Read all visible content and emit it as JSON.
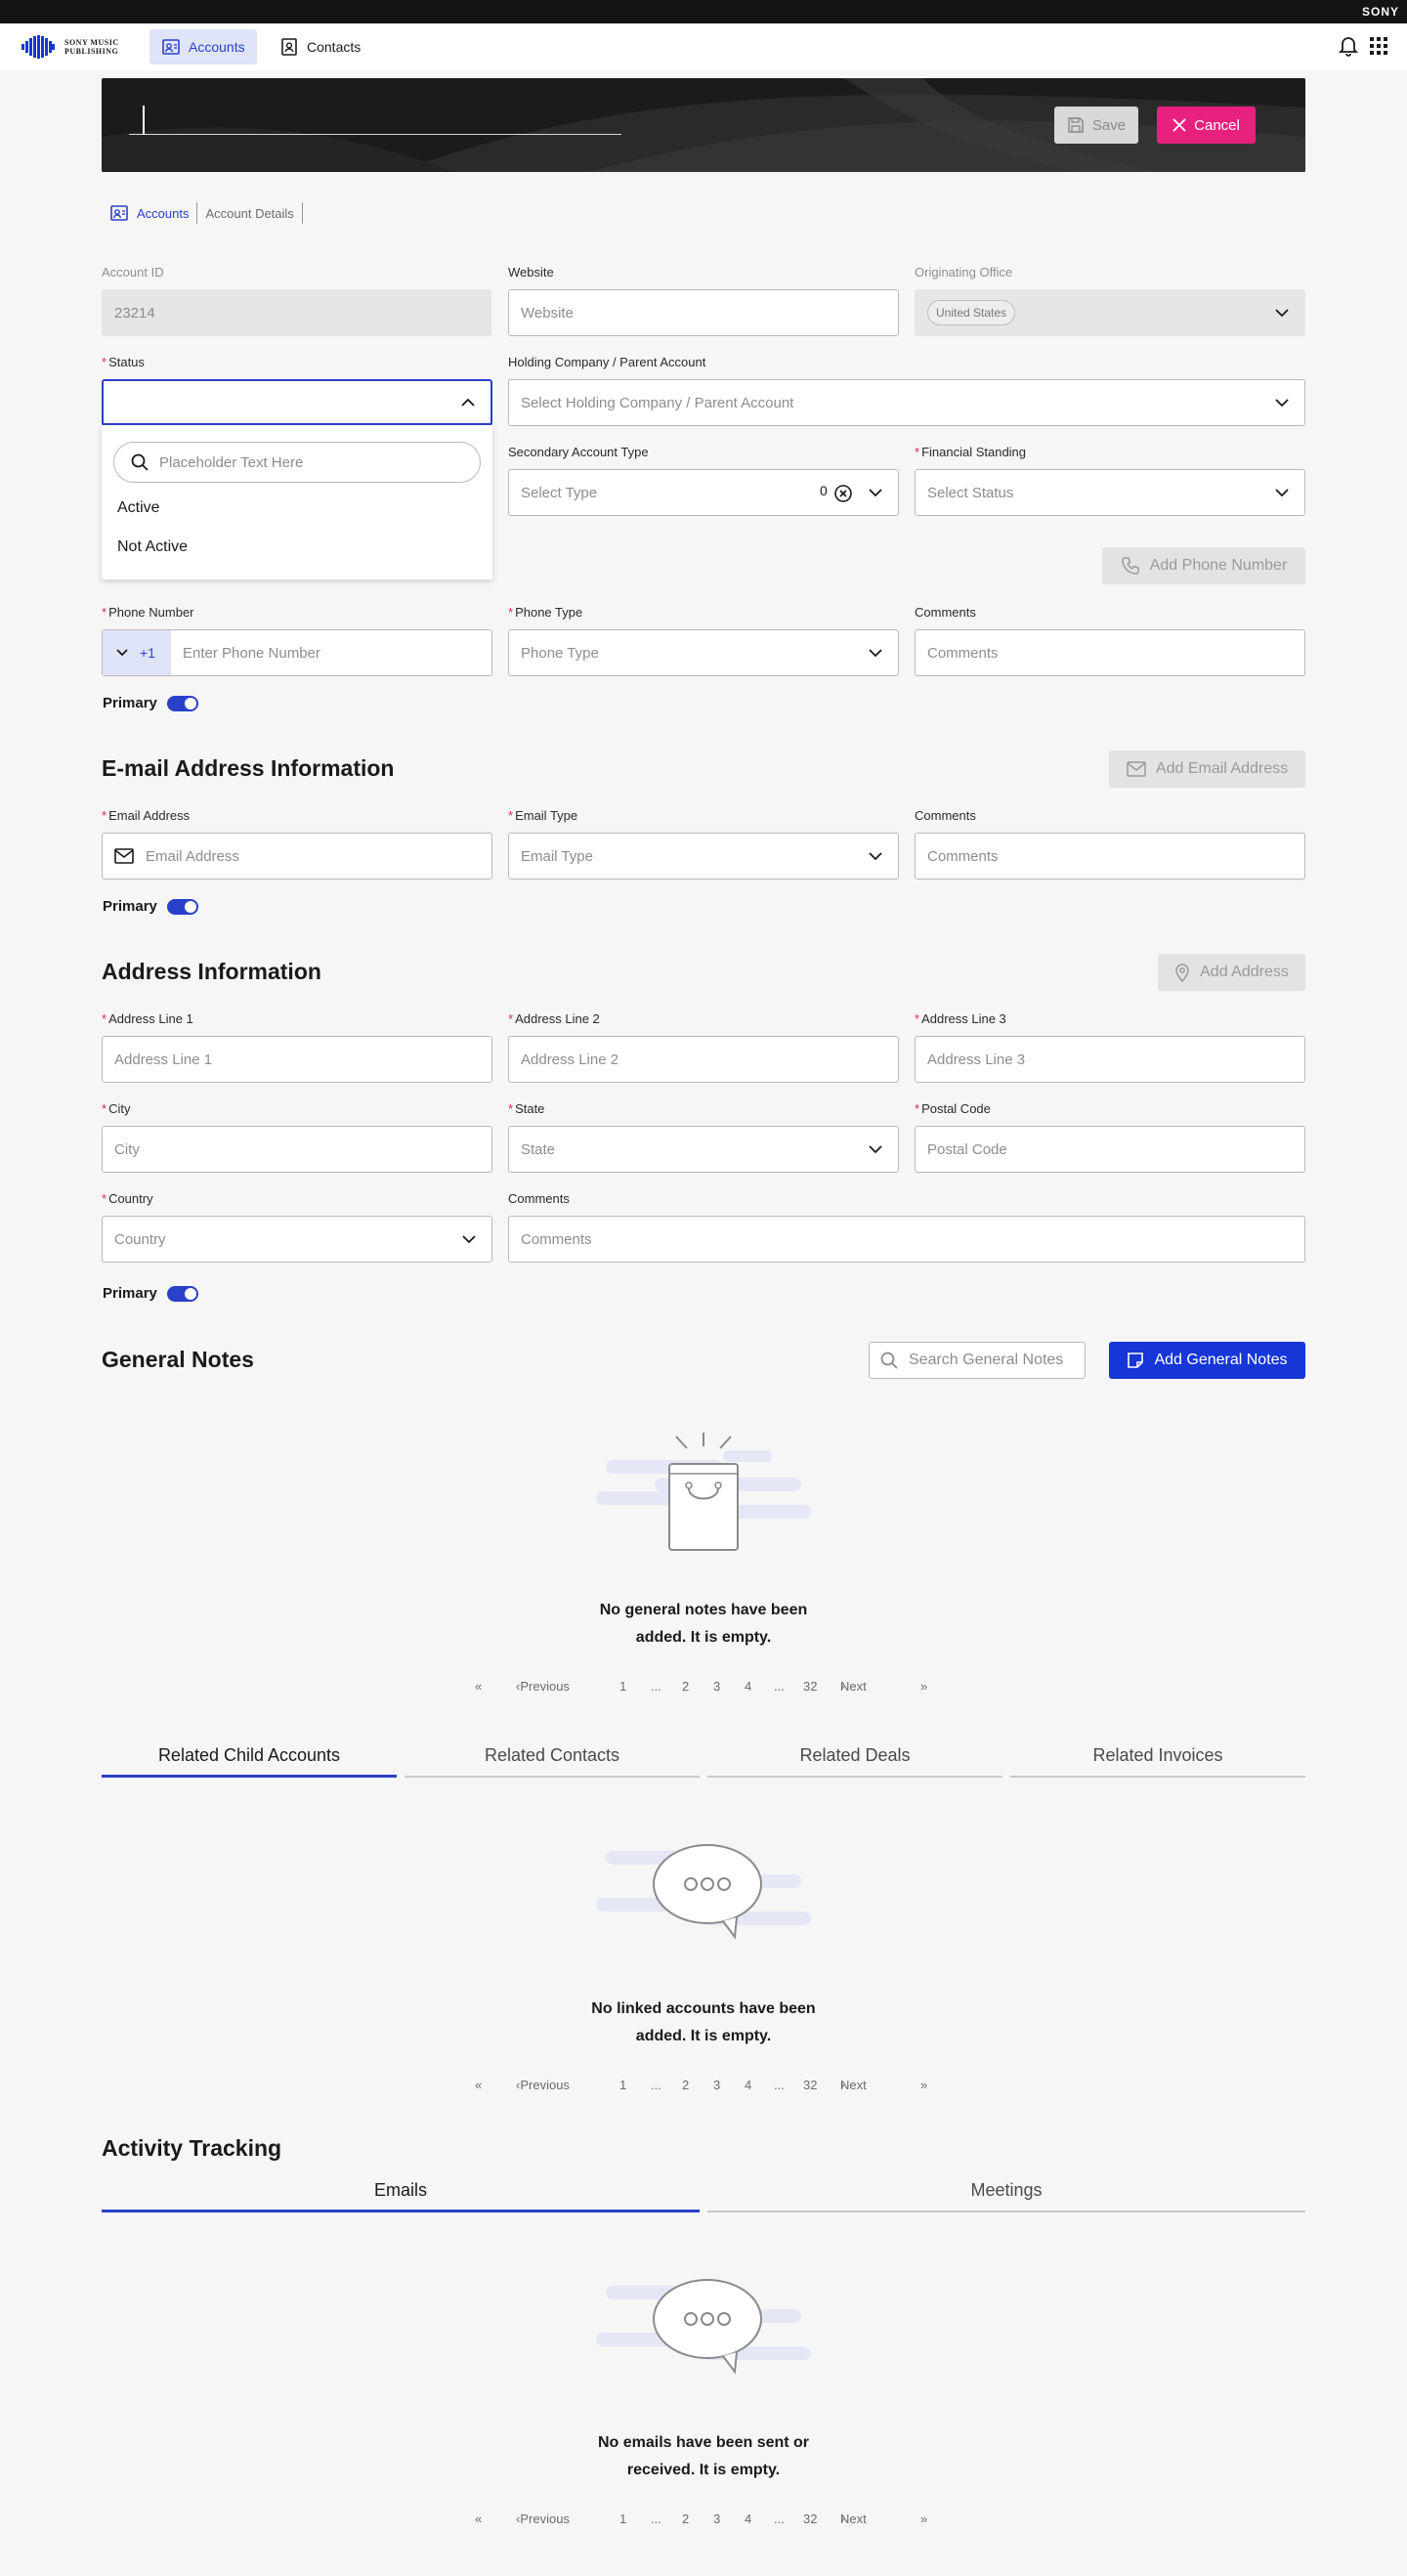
{
  "brand": {
    "line1": "SONY MUSIC",
    "line2": "PUBLISHING",
    "corner": "SONY"
  },
  "nav": {
    "accounts": "Accounts",
    "contacts": "Contacts"
  },
  "hero": {
    "save": "Save",
    "cancel": "Cancel"
  },
  "breadcrumb": {
    "accounts": "Accounts",
    "details": "Account Details"
  },
  "account": {
    "account_id": {
      "label": "Account ID",
      "value": "23214"
    },
    "website": {
      "label": "Website",
      "placeholder": "Website"
    },
    "originating_office": {
      "label": "Originating Office",
      "value": "United States"
    },
    "status": {
      "label": "Status"
    },
    "holding_company": {
      "label": "Holding Company / Parent Account",
      "placeholder": "Select Holding Company / Parent Account"
    },
    "secondary_type": {
      "label": "Secondary Account Type",
      "placeholder": "Select Type",
      "count": "0"
    },
    "financial_standing": {
      "label": "Financial Standing",
      "placeholder": "Select Status"
    }
  },
  "status_dropdown": {
    "search_placeholder": "Placeholder Text Here",
    "options": [
      "Active",
      "Not Active"
    ]
  },
  "phone": {
    "add_button": "Add Phone Number",
    "number": {
      "label": "Phone Number",
      "prefix": "+1",
      "placeholder": "Enter Phone Number"
    },
    "type": {
      "label": "Phone Type",
      "placeholder": "Phone Type"
    },
    "comments": {
      "label": "Comments",
      "placeholder": "Comments"
    },
    "primary": "Primary"
  },
  "email": {
    "title": "E-mail Address Information",
    "add_button": "Add Email Address",
    "address": {
      "label": "Email Address",
      "placeholder": "Email Address"
    },
    "type": {
      "label": "Email Type",
      "placeholder": "Email Type"
    },
    "comments": {
      "label": "Comments",
      "placeholder": "Comments"
    },
    "primary": "Primary"
  },
  "address": {
    "title": "Address Information",
    "add_button": "Add Address",
    "line1": {
      "label": "Address Line 1",
      "placeholder": "Address Line 1"
    },
    "line2": {
      "label": "Address Line 2",
      "placeholder": "Address Line 2"
    },
    "line3": {
      "label": "Address Line 3",
      "placeholder": "Address Line 3"
    },
    "city": {
      "label": "City",
      "placeholder": "City"
    },
    "state": {
      "label": "State",
      "placeholder": "State"
    },
    "postal": {
      "label": "Postal Code",
      "placeholder": "Postal Code"
    },
    "country": {
      "label": "Country",
      "placeholder": "Country"
    },
    "comments": {
      "label": "Comments",
      "placeholder": "Comments"
    },
    "primary": "Primary"
  },
  "notes": {
    "title": "General Notes",
    "search_placeholder": "Search General Notes",
    "add_button": "Add General Notes",
    "empty_line1": "No general notes have been",
    "empty_line2": "added. It is empty."
  },
  "pagination": {
    "previous": "Previous",
    "next": "Next",
    "pages": [
      "1",
      "...",
      "2",
      "3",
      "4",
      "...",
      "32"
    ]
  },
  "related": {
    "tabs": [
      "Related Child Accounts",
      "Related Contacts",
      "Related Deals",
      "Related Invoices"
    ],
    "empty_line1": "No linked accounts have been",
    "empty_line2": "added. It is empty."
  },
  "activity": {
    "title": "Activity Tracking",
    "tabs": [
      "Emails",
      "Meetings"
    ],
    "empty_line1": "No emails have been sent or",
    "empty_line2": "received. It is empty."
  },
  "colors": {
    "accent": "#2a40c8",
    "primary_button": "#1636d8",
    "cancel": "#e8217f",
    "required": "#e0245e"
  }
}
